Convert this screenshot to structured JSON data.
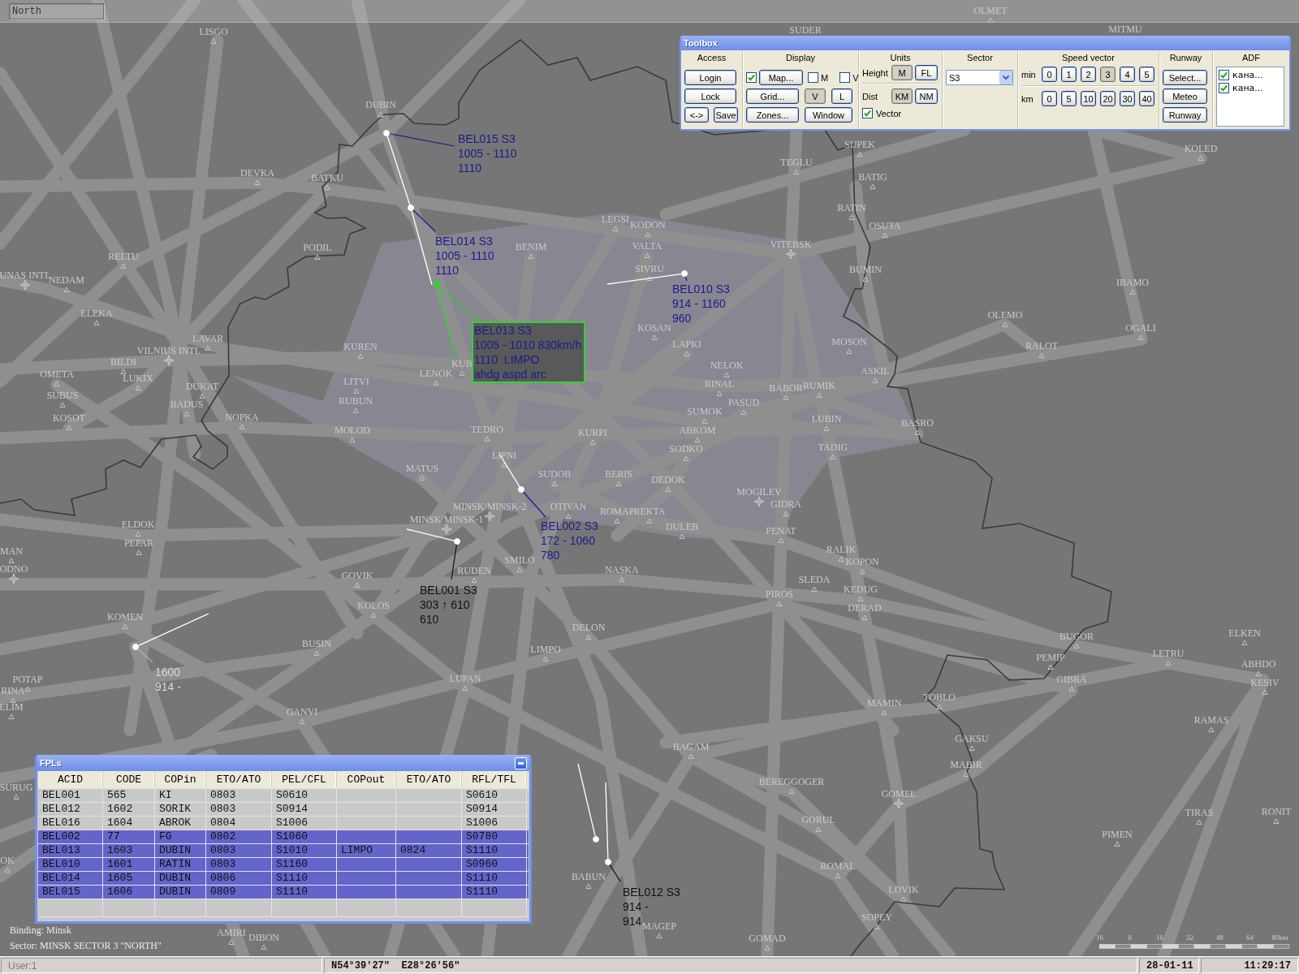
{
  "top_bar": {
    "sector_field": "North"
  },
  "toolbox": {
    "title": "Toolbox",
    "access": {
      "heading": "Access",
      "login": "Login",
      "lock": "Lock",
      "swap": "<->",
      "save": "Save"
    },
    "display": {
      "heading": "Display",
      "map": {
        "label": "Map...",
        "checked": true
      },
      "checks": [
        {
          "label": "M",
          "checked": false
        },
        {
          "label": "V",
          "checked": false
        }
      ],
      "grid": "Grid...",
      "zones": "Zones...",
      "window": "Window",
      "toggles": [
        {
          "label": "V",
          "pressed": true
        },
        {
          "label": "L",
          "pressed": false
        }
      ]
    },
    "units": {
      "heading": "Units",
      "height": {
        "label": "Height",
        "options": [
          {
            "label": "M",
            "pressed": true
          },
          {
            "label": "FL",
            "pressed": false
          }
        ]
      },
      "dist": {
        "label": "Dist",
        "options": [
          {
            "label": "KM",
            "pressed": true
          },
          {
            "label": "NM",
            "pressed": false
          }
        ]
      },
      "vector": {
        "label": "Vector",
        "checked": true
      }
    },
    "sector": {
      "heading": "Sector",
      "value": "S3"
    },
    "speed_vector": {
      "heading": "Speed vector",
      "rows": [
        {
          "label": "min",
          "options": [
            {
              "label": "0",
              "pressed": false
            },
            {
              "label": "1",
              "pressed": false
            },
            {
              "label": "2",
              "pressed": false
            },
            {
              "label": "3",
              "pressed": true
            },
            {
              "label": "4",
              "pressed": false
            },
            {
              "label": "5",
              "pressed": false
            }
          ]
        },
        {
          "label": "km",
          "options": [
            {
              "label": "0",
              "pressed": false
            },
            {
              "label": "5",
              "pressed": false
            },
            {
              "label": "10",
              "pressed": false
            },
            {
              "label": "20",
              "pressed": false
            },
            {
              "label": "30",
              "pressed": false
            },
            {
              "label": "40",
              "pressed": false
            }
          ]
        }
      ]
    },
    "runway": {
      "heading": "Runway",
      "buttons": [
        "Select...",
        "Meteo",
        "Runway"
      ]
    },
    "adf": {
      "heading": "ADF",
      "items": [
        {
          "label": "кана...",
          "checked": true
        },
        {
          "label": "кана...",
          "checked": true
        }
      ]
    }
  },
  "map": {
    "waypoints": [
      {
        "name": "OLMET",
        "kind": "fix"
      },
      {
        "name": "LISGO",
        "kind": "fix"
      },
      {
        "name": "SUDER",
        "kind": "fix"
      },
      {
        "name": "MITMU",
        "kind": "fix"
      },
      {
        "name": "DUBIN",
        "kind": "fix"
      },
      {
        "name": "SUPEK",
        "kind": "fix"
      },
      {
        "name": "KOLED",
        "kind": "fix"
      },
      {
        "name": "TEGLU",
        "kind": "fix"
      },
      {
        "name": "DEVKA",
        "kind": "fix"
      },
      {
        "name": "BATKU",
        "kind": "fix"
      },
      {
        "name": "BATIG",
        "kind": "fix"
      },
      {
        "name": "RATIN",
        "kind": "fix"
      },
      {
        "name": "LEGSI",
        "kind": "fix"
      },
      {
        "name": "KODON",
        "kind": "fix"
      },
      {
        "name": "OSUTA",
        "kind": "fix"
      },
      {
        "name": "PODIL",
        "kind": "fix"
      },
      {
        "name": "BENIM",
        "kind": "fix"
      },
      {
        "name": "VALTA",
        "kind": "fix"
      },
      {
        "name": "VITEBSK",
        "kind": "airport"
      },
      {
        "name": "RELTU",
        "kind": "fix"
      },
      {
        "name": "SIVRU",
        "kind": "fix"
      },
      {
        "name": "BUMIN",
        "kind": "fix"
      },
      {
        "name": "UNAS INTL",
        "kind": "airport"
      },
      {
        "name": "NEDAM",
        "kind": "fix"
      },
      {
        "name": "IBAMO",
        "kind": "fix"
      },
      {
        "name": "ELEKA",
        "kind": "fix"
      },
      {
        "name": "OLEMO",
        "kind": "fix"
      },
      {
        "name": "KOSAN",
        "kind": "fix"
      },
      {
        "name": "OGALI",
        "kind": "fix"
      },
      {
        "name": "VILNIUS INTL",
        "kind": "airport"
      },
      {
        "name": "LAVAR",
        "kind": "fix"
      },
      {
        "name": "KUREN",
        "kind": "fix"
      },
      {
        "name": "LAPKI",
        "kind": "fix"
      },
      {
        "name": "MOSON",
        "kind": "fix"
      },
      {
        "name": "RALOT",
        "kind": "fix"
      },
      {
        "name": "BILDI",
        "kind": "fix"
      },
      {
        "name": "KUB",
        "kind": "fix"
      },
      {
        "name": "NELOK",
        "kind": "fix"
      },
      {
        "name": "OMETA",
        "kind": "fix"
      },
      {
        "name": "LENOK",
        "kind": "fix"
      },
      {
        "name": "ASKIL",
        "kind": "fix"
      },
      {
        "name": "LUKIX",
        "kind": "fix"
      },
      {
        "name": "DUKAT",
        "kind": "fix"
      },
      {
        "name": "LITVI",
        "kind": "fix"
      },
      {
        "name": "RINAL",
        "kind": "fix"
      },
      {
        "name": "BABOR",
        "kind": "fix"
      },
      {
        "name": "RUMIK",
        "kind": "fix"
      },
      {
        "name": "SUBUS",
        "kind": "fix"
      },
      {
        "name": "BADUS",
        "kind": "fix"
      },
      {
        "name": "RUBUN",
        "kind": "fix"
      },
      {
        "name": "PASUD",
        "kind": "fix"
      },
      {
        "name": "KOSOT",
        "kind": "fix"
      },
      {
        "name": "NOPKA",
        "kind": "fix"
      },
      {
        "name": "SUMOK",
        "kind": "fix"
      },
      {
        "name": "LUBIN",
        "kind": "fix"
      },
      {
        "name": "BASRO",
        "kind": "fix"
      },
      {
        "name": "MOLOD",
        "kind": "fix"
      },
      {
        "name": "TEDRO",
        "kind": "fix"
      },
      {
        "name": "KURPI",
        "kind": "fix"
      },
      {
        "name": "ABKOM",
        "kind": "fix"
      },
      {
        "name": "LIPNI",
        "kind": "fix"
      },
      {
        "name": "SODKO",
        "kind": "fix"
      },
      {
        "name": "TADIG",
        "kind": "fix"
      },
      {
        "name": "MATUS",
        "kind": "fix"
      },
      {
        "name": "SUDOB",
        "kind": "fix"
      },
      {
        "name": "BERIS",
        "kind": "fix"
      },
      {
        "name": "DEDOK",
        "kind": "fix"
      },
      {
        "name": "MOGILEV",
        "kind": "airport"
      },
      {
        "name": "MINSK/MINSK-2",
        "kind": "airport"
      },
      {
        "name": "OTIVAN",
        "kind": "fix"
      },
      {
        "name": "ROMAP",
        "kind": "fix"
      },
      {
        "name": "REKTA",
        "kind": "fix"
      },
      {
        "name": "GIDRA",
        "kind": "fix"
      },
      {
        "name": "ELDOK",
        "kind": "fix"
      },
      {
        "name": "MINSK/MINSK-1",
        "kind": "airport"
      },
      {
        "name": "DULEB",
        "kind": "fix"
      },
      {
        "name": "PENAT",
        "kind": "fix"
      },
      {
        "name": "MAN",
        "kind": "fix"
      },
      {
        "name": "PEPAR",
        "kind": "fix"
      },
      {
        "name": "RALIK",
        "kind": "fix"
      },
      {
        "name": "ODNO",
        "kind": "airport"
      },
      {
        "name": "GOVIK",
        "kind": "fix"
      },
      {
        "name": "RUDEN",
        "kind": "fix"
      },
      {
        "name": "SMILO",
        "kind": "fix"
      },
      {
        "name": "NASKA",
        "kind": "fix"
      },
      {
        "name": "KOPON",
        "kind": "fix"
      },
      {
        "name": "SLEDA",
        "kind": "fix"
      },
      {
        "name": "PIROS",
        "kind": "fix"
      },
      {
        "name": "KEDUG",
        "kind": "fix"
      },
      {
        "name": "KOMEN",
        "kind": "fix"
      },
      {
        "name": "KOLOS",
        "kind": "fix"
      },
      {
        "name": "DERAD",
        "kind": "fix"
      },
      {
        "name": "DELON",
        "kind": "fix"
      },
      {
        "name": "BUGOR",
        "kind": "fix"
      },
      {
        "name": "ELKEN",
        "kind": "fix"
      },
      {
        "name": "BUSIN",
        "kind": "fix"
      },
      {
        "name": "LIMPO",
        "kind": "fix"
      },
      {
        "name": "PEMIP",
        "kind": "fix"
      },
      {
        "name": "LETRU",
        "kind": "fix"
      },
      {
        "name": "ABHDO",
        "kind": "fix"
      },
      {
        "name": "POTAP",
        "kind": "fix"
      },
      {
        "name": "LUPAN",
        "kind": "fix"
      },
      {
        "name": "GIBRA",
        "kind": "fix"
      },
      {
        "name": "KESIV",
        "kind": "fix"
      },
      {
        "name": "RINA",
        "kind": "fix"
      },
      {
        "name": "ELIM",
        "kind": "fix"
      },
      {
        "name": "MAMIN",
        "kind": "fix"
      },
      {
        "name": "TOBLO",
        "kind": "fix"
      },
      {
        "name": "GANVI",
        "kind": "fix"
      },
      {
        "name": "RAMAS",
        "kind": "fix"
      },
      {
        "name": "BAGAM",
        "kind": "fix"
      },
      {
        "name": "GAKSU",
        "kind": "fix"
      },
      {
        "name": "MABIR",
        "kind": "fix"
      },
      {
        "name": "SURUG",
        "kind": "fix"
      },
      {
        "name": "BEREGGOGER",
        "kind": "fix"
      },
      {
        "name": "GOMEL",
        "kind": "airport"
      },
      {
        "name": "GORUL",
        "kind": "fix"
      },
      {
        "name": "TIRAS",
        "kind": "fix"
      },
      {
        "name": "RONIT",
        "kind": "fix"
      },
      {
        "name": "PIMEN",
        "kind": "fix"
      },
      {
        "name": "OK",
        "kind": "fix"
      },
      {
        "name": "BABUN",
        "kind": "fix"
      },
      {
        "name": "ROMAL",
        "kind": "fix"
      },
      {
        "name": "LOVIK",
        "kind": "fix"
      },
      {
        "name": "MAGEP",
        "kind": "fix"
      },
      {
        "name": "SOPEY",
        "kind": "fix"
      },
      {
        "name": "AMIRI",
        "kind": "fix"
      },
      {
        "name": "DIBON",
        "kind": "fix"
      },
      {
        "name": "GOMAD",
        "kind": "fix"
      }
    ],
    "tracks": [
      {
        "kind": "assumed",
        "label": [
          "BEL015 S3",
          "1005 - 1110",
          "1110"
        ]
      },
      {
        "kind": "assumed",
        "label": [
          "BEL014 S3",
          "1005 - 1110",
          "1110"
        ]
      },
      {
        "kind": "selected",
        "label": [
          "BEL013 S3",
          "1005 - 1010 830km/h",
          "1110  LIMPO",
          "ahdg aspd arc"
        ]
      },
      {
        "kind": "assumed",
        "label": [
          "BEL010 S3",
          "914 - 1160",
          "960"
        ]
      },
      {
        "kind": "assumed",
        "label": [
          "BEL002 S3",
          "172 - 1060",
          "780"
        ]
      },
      {
        "kind": "not_concerned",
        "label": [
          "BEL001 S3",
          "303 ↑ 610",
          "610"
        ]
      },
      {
        "kind": "unknown",
        "label": [
          "1600",
          "914 -"
        ]
      },
      {
        "kind": "not_concerned",
        "label": [
          "BEL012 S3",
          "914 -",
          "914"
        ]
      }
    ],
    "binding": "Binding: Minsk",
    "sector": "Sector: MINSK SECTOR 3 \"NORTH\"",
    "scale": [
      "16",
      "0",
      "16",
      "32",
      "48",
      "64",
      "80km"
    ]
  },
  "fpl_window": {
    "title": "FPLs",
    "columns": [
      "ACID",
      "CODE",
      "COPin",
      "ETO/ATO",
      "PEL/CFL",
      "COPout",
      "ETO/ATO",
      "RFL/TFL"
    ],
    "rows": [
      {
        "acid": "BEL001",
        "code": "565",
        "cop_in": "KI",
        "eto_in": "0803",
        "pel_cfl": "S0610",
        "rfl_tfl": "S0610",
        "selected": false
      },
      {
        "acid": "BEL012",
        "code": "1602",
        "cop_in": "SORIK",
        "eto_in": "0803",
        "pel_cfl": "S0914",
        "rfl_tfl": "S0914",
        "selected": false
      },
      {
        "acid": "BEL016",
        "code": "1604",
        "cop_in": "ABROK",
        "eto_in": "0804",
        "pel_cfl": "S1006",
        "rfl_tfl": "S1006",
        "selected": false
      },
      {
        "acid": "BEL002",
        "code": "77",
        "cop_in": "FG",
        "eto_in": "0802",
        "pel_cfl": "S1060",
        "rfl_tfl": "S0780",
        "selected": true
      },
      {
        "acid": "BEL013",
        "code": "1603",
        "cop_in": "DUBIN",
        "eto_in": "0803",
        "pel_cfl": "S1010",
        "cop_out": "LIMPO",
        "eto_out": "0824",
        "rfl_tfl": "S1110",
        "selected": true
      },
      {
        "acid": "BEL010",
        "code": "1601",
        "cop_in": "RATIN",
        "eto_in": "0803",
        "pel_cfl": "S1160",
        "rfl_tfl": "S0960",
        "selected": true
      },
      {
        "acid": "BEL014",
        "code": "1605",
        "cop_in": "DUBIN",
        "eto_in": "0806",
        "pel_cfl": "S1110",
        "rfl_tfl": "S1110",
        "selected": true
      },
      {
        "acid": "BEL015",
        "code": "1606",
        "cop_in": "DUBIN",
        "eto_in": "0809",
        "pel_cfl": "S1110",
        "rfl_tfl": "S1110",
        "selected": true
      }
    ]
  },
  "status_bar": {
    "user": "User:1",
    "position": "N54°39'27\"  E28°26'56\"",
    "date": "28-01-11",
    "time": "11:29:17"
  }
}
